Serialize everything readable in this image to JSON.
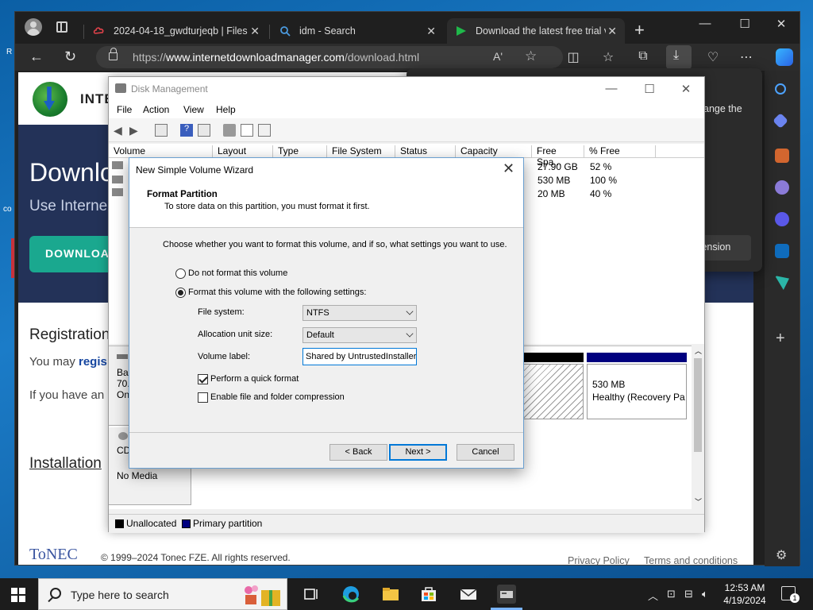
{
  "browser": {
    "tabs": [
      {
        "title": "2024-04-18_gwdturjeqb | Files"
      },
      {
        "title": "idm - Search"
      },
      {
        "title": "Download the latest free trial v"
      }
    ],
    "url_prefix": "https://",
    "url_domain": "www.internetdownloadmanager.com",
    "url_path": "/download.html",
    "read_aloud": "Aʹ",
    "win_min": "—",
    "win_max": "☐",
    "win_close": "✕"
  },
  "website": {
    "brand": "INTE",
    "hero_title": "Downlo",
    "hero_sub": "Use Interne",
    "download_btn": "DOWNLOA",
    "reg_title": "Registration",
    "reg_line1_prefix": "You may ",
    "reg_line1_link": "regis",
    "reg_line2": "If you have an",
    "install_title": "Installation",
    "tonec": "ToNEC",
    "copyright": "© 1999–2024 Tonec FZE. All rights reserved.",
    "privacy": "Privacy Policy",
    "terms": "Terms and conditions"
  },
  "popup": {
    "fragment": "ange the",
    "ext_button": "tension"
  },
  "disk_mgmt": {
    "title": "Disk Management",
    "menu": [
      "File",
      "Action",
      "View",
      "Help"
    ],
    "columns": [
      "Volume",
      "Layout",
      "Type",
      "File System",
      "Status",
      "Capacity",
      "Free Spa...",
      "% Free"
    ],
    "rows": [
      {
        "free": "27.90 GB",
        "pct": "52 %"
      },
      {
        "free": "530 MB",
        "pct": "100 %"
      },
      {
        "free": "20 MB",
        "pct": "40 %"
      }
    ],
    "disk0_frag": [
      "Ba",
      "70.",
      "On"
    ],
    "cd_label": "CD",
    "no_media": "No Media",
    "recovery_size": "530 MB",
    "recovery_status": "Healthy (Recovery Pa",
    "legend_unalloc": "Unallocated",
    "legend_primary": "Primary partition",
    "colors": {
      "unallocated": "#000000",
      "primary": "#00007f"
    }
  },
  "wizard": {
    "title": "New Simple Volume Wizard",
    "heading": "Format Partition",
    "subheading": "To store data on this partition, you must format it first.",
    "instruction": "Choose whether you want to format this volume, and if so, what settings you want to use.",
    "opt_noformat": "Do not format this volume",
    "opt_format": "Format this volume with the following settings:",
    "fs_label": "File system:",
    "fs_value": "NTFS",
    "alloc_label": "Allocation unit size:",
    "alloc_value": "Default",
    "vol_label": "Volume label:",
    "vol_value": "Shared by UntrustedInstaller",
    "quick_format": "Perform a quick format",
    "compression": "Enable file and folder compression",
    "back": "< Back",
    "next": "Next >",
    "cancel": "Cancel"
  },
  "taskbar": {
    "search_placeholder": "Type here to search",
    "time": "12:53 AM",
    "date": "4/19/2024",
    "notif_count": "1"
  }
}
